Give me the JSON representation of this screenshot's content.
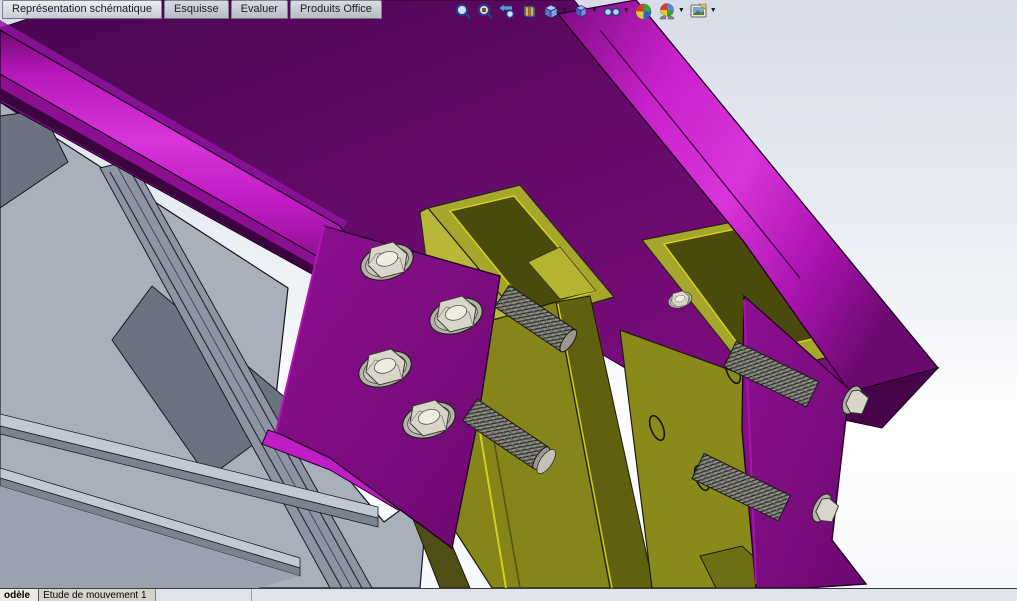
{
  "command_tabs": {
    "items": [
      {
        "label": "Représentation schématique",
        "active": true
      },
      {
        "label": "Esquisse",
        "active": false
      },
      {
        "label": "Evaluer",
        "active": false
      },
      {
        "label": "Produits Office",
        "active": false
      }
    ]
  },
  "hud_toolbar": {
    "icons": [
      {
        "name": "zoom-to-fit-icon",
        "dropdown": false
      },
      {
        "name": "zoom-to-area-icon",
        "dropdown": false
      },
      {
        "name": "previous-view-icon",
        "dropdown": false
      },
      {
        "name": "section-view-icon",
        "dropdown": false
      },
      {
        "name": "view-orientation-icon",
        "dropdown": true
      },
      {
        "name": "display-style-icon",
        "dropdown": true
      },
      {
        "name": "hide-show-items-icon",
        "dropdown": true
      },
      {
        "name": "edit-appearance-icon",
        "dropdown": false
      },
      {
        "name": "apply-scene-icon",
        "dropdown": true
      },
      {
        "name": "view-settings-icon",
        "dropdown": true
      }
    ],
    "dropdown_glyph": "▼"
  },
  "bottom_tabs": {
    "items": [
      {
        "label": "odèle",
        "active": true
      },
      {
        "label": "Etude de mouvement 1",
        "active": false
      }
    ]
  },
  "scene": {
    "description": "SolidWorks 3D viewport: bolted steel connection — magenta I-beams, olive square hollow tubes, gray ribbed base plates, hex nuts and threaded studs",
    "colors": {
      "bg_top": "#d7dce8",
      "bg_white": "#ffffff",
      "web_purple": "#640a68",
      "magenta_bright": "#c41ec8",
      "plate_purple": "#8a0f8e",
      "flange_dark": "#46054a",
      "olive_top": "#a6a62c",
      "olive_front": "#85851a",
      "olive_front2": "#8a8a1a",
      "olive_dark": "#4e4e10",
      "olive_rim": "#d8d818",
      "gray_light": "#a9b0bc",
      "gray_mid": "#8d95a3",
      "gray_dark": "#6b7280",
      "red_dark": "#7c1016",
      "steel_light": "#d9d6c9",
      "steel_mid": "#b5b3a8",
      "bar_bg": "#dfe3eb"
    }
  }
}
